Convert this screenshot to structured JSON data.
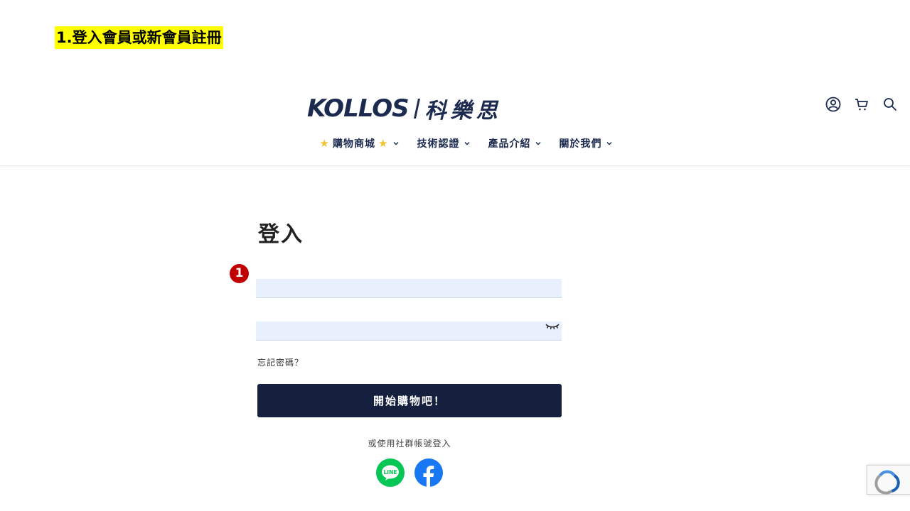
{
  "step_label": "1.登入會員或新會員註冊",
  "header": {
    "logo_latin": "KOLLOS",
    "logo_cn": "科樂思",
    "icons": [
      "account-icon",
      "cart-icon",
      "search-icon"
    ]
  },
  "nav": {
    "items": [
      {
        "label": "購物商城",
        "decorated": true
      },
      {
        "label": "技術認證"
      },
      {
        "label": "產品介紹"
      },
      {
        "label": "關於我們"
      }
    ]
  },
  "login": {
    "title": "登入",
    "marker": "1",
    "email_value": "",
    "password_value": "",
    "forgot_label": "忘記密碼？",
    "submit_label": "開始購物吧！",
    "social_label": "或使用社群帳號登入",
    "line_label": "LINE"
  },
  "colors": {
    "brand_navy": "#1b2a4e",
    "button_bg": "#151f3e",
    "field_bg": "#e8f0fe",
    "highlight": "#ffff00",
    "marker_red": "#c00000",
    "line_green": "#06c755",
    "facebook_blue": "#1877f2"
  }
}
